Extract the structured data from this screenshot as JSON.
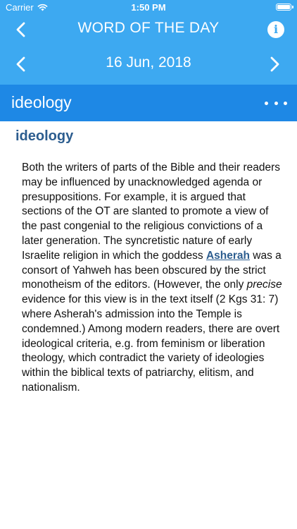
{
  "status_bar": {
    "carrier": "Carrier",
    "time": "1:50 PM"
  },
  "nav": {
    "title": "WORD OF THE DAY",
    "back_icon": "chevron-left-icon",
    "info_icon": "info-icon"
  },
  "date_bar": {
    "date": "16 Jun, 2018",
    "prev_icon": "chevron-left-icon",
    "next_icon": "chevron-right-icon"
  },
  "word_bar": {
    "title": "ideology",
    "more_icon": "more-horizontal-icon"
  },
  "entry": {
    "heading": "ideology",
    "body_part1": "Both the writers of parts of the Bible and their readers may be influenced by unacknowledged agenda or presuppositions. For example, it is argued that sections of the OT are slanted to promote a view of the past congenial to the religious convictions of a later generation. The syncretistic nature of early Israelite religion in which the goddess ",
    "link_text": "Asherah",
    "body_part2": " was a consort of Yahweh has been obscured by the strict monotheism of the editors. (However, the only ",
    "emphasis_text": "precise",
    "body_part3": " evidence for this view is in the text itself (2 Kgs 31: 7) where Asherah's admission into the Temple is condemned.) Among modern readers, there are overt ideological criteria, e.g. from feminism or liberation theology, which contradict the variety of ideologies within the biblical texts of patriarchy, elitism, and nationalism."
  },
  "colors": {
    "header_bg": "#3da9f1",
    "word_bar_bg": "#1e88e5",
    "heading_text": "#2c5d8f",
    "body_text": "#111111"
  }
}
